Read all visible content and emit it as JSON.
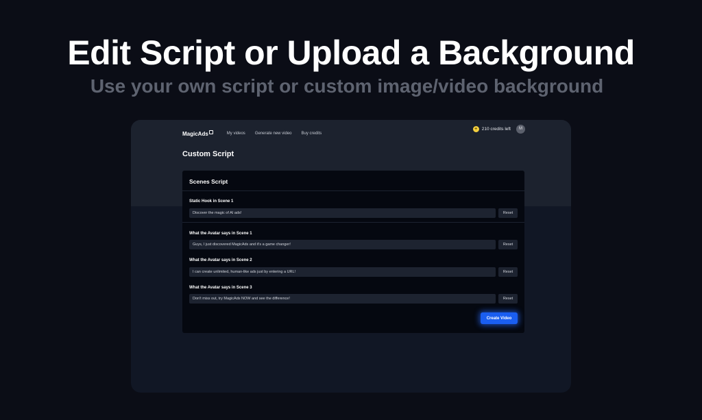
{
  "hero": {
    "title": "Edit Script or Upload a Background",
    "subtitle": "Use your own script or custom image/video background"
  },
  "navbar": {
    "logo": "MagicAds",
    "links": [
      "My videos",
      "Generate new video",
      "Buy credits"
    ],
    "credits": "210 credits left",
    "avatar_initial": "M"
  },
  "page": {
    "title": "Custom Script"
  },
  "panel": {
    "title": "Scenes Script",
    "fields": [
      {
        "label": "Static Hook in Scene 1",
        "value": "Discover the magic of AI ads!",
        "reset_label": "Reset"
      },
      {
        "label": "What the Avatar says in Scene 1",
        "value": "Guys, I just discovered MagicAds and it's a game changer!",
        "reset_label": "Reset"
      },
      {
        "label": "What the Avatar says in Scene 2",
        "value": "I can create unlimited, human-like ads just by entering a URL!",
        "reset_label": "Reset"
      },
      {
        "label": "What the Avatar says in Scene 3",
        "value": "Don't miss out, try MagicAds NOW and see the difference!",
        "reset_label": "Reset"
      }
    ],
    "create_button": "Create Video"
  },
  "colors": {
    "accent": "#1a5ef0",
    "coin": "#f4d03f",
    "background": "#0b0d16"
  }
}
